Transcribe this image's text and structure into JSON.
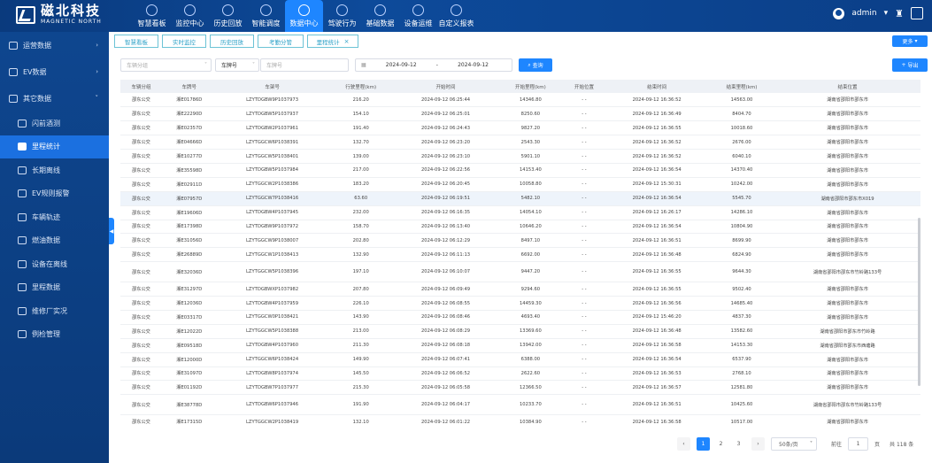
{
  "brand": {
    "cn": "磁北科技",
    "en": "MAGNETIC NORTH"
  },
  "nav": [
    {
      "label": "智慧看板",
      "icon": "dashboard-icon"
    },
    {
      "label": "监控中心",
      "icon": "monitor-icon"
    },
    {
      "label": "历史回放",
      "icon": "replay-icon"
    },
    {
      "label": "智能调度",
      "icon": "dispatch-icon"
    },
    {
      "label": "数据中心",
      "icon": "data-icon",
      "active": true
    },
    {
      "label": "驾驶行为",
      "icon": "driving-icon"
    },
    {
      "label": "基础数据",
      "icon": "database-icon"
    },
    {
      "label": "设备运维",
      "icon": "device-icon"
    },
    {
      "label": "自定义报表",
      "icon": "report-icon"
    }
  ],
  "user": {
    "name": "admin"
  },
  "sidebar": [
    {
      "label": "运营数据",
      "type": "group",
      "chev": "›"
    },
    {
      "label": "EV数据",
      "type": "group",
      "chev": "›"
    },
    {
      "label": "其它数据",
      "type": "group",
      "chev": "˅"
    },
    {
      "label": "闪前酒测",
      "type": "sub"
    },
    {
      "label": "里程统计",
      "type": "sub",
      "active": true
    },
    {
      "label": "长期离线",
      "type": "sub"
    },
    {
      "label": "EV规则报警",
      "type": "sub"
    },
    {
      "label": "车辆轨迹",
      "type": "sub"
    },
    {
      "label": "燃油数据",
      "type": "sub"
    },
    {
      "label": "设备在离线",
      "type": "sub"
    },
    {
      "label": "里程数据",
      "type": "sub"
    },
    {
      "label": "维修厂实况",
      "type": "sub"
    },
    {
      "label": "例检管理",
      "type": "sub"
    }
  ],
  "tabs": [
    {
      "label": "智慧看板"
    },
    {
      "label": "实时监控"
    },
    {
      "label": "历史回放"
    },
    {
      "label": "考勤分管"
    },
    {
      "label": "里程统计",
      "active": true,
      "close": "×"
    }
  ],
  "more_label": "更多",
  "filters": {
    "group_placeholder": "车辆分组",
    "plate_select": "车牌号",
    "plate_placeholder": "车牌号",
    "date_start": "2024-09-12",
    "date_sep": "-",
    "date_end": "2024-09-12",
    "query_label": "查询",
    "export_label": "导出"
  },
  "table": {
    "columns": [
      "车辆分组",
      "车牌号",
      "车架号",
      "行驶里程(km)",
      "开始时间",
      "开始里程(km)",
      "开始位置",
      "结束时间",
      "结束里程(km)",
      "结束位置"
    ],
    "rows": [
      [
        "邵东公交",
        "湘E01786D",
        "LZYTDGBW9P1037973",
        "216.20",
        "2024-09-12 06:25:44",
        "14346.80",
        "- -",
        "2024-09-12 16:36:52",
        "14563.00",
        "湖南省邵阳市邵东市"
      ],
      [
        "邵东公交",
        "湘E22290D",
        "LZYTDGBW5P1037937",
        "154.10",
        "2024-09-12 06:25:01",
        "8250.60",
        "- -",
        "2024-09-12 16:36:49",
        "8404.70",
        "湖南省邵阳市邵东市"
      ],
      [
        "邵东公交",
        "湘E02357D",
        "LZYTDGBW2P1037961",
        "191.40",
        "2024-09-12 06:24:43",
        "9827.20",
        "- -",
        "2024-09-12 16:36:55",
        "10018.60",
        "湖南省邵阳市邵东市"
      ],
      [
        "邵东公交",
        "湘E04666D",
        "LZYTGGCW6P1038391",
        "132.70",
        "2024-09-12 06:23:20",
        "2543.30",
        "- -",
        "2024-09-12 16:36:52",
        "2676.00",
        "湖南省邵阳市邵东市"
      ],
      [
        "邵东公交",
        "湘E10277D",
        "LZYTGGCW5P1038401",
        "139.00",
        "2024-09-12 06:23:10",
        "5901.10",
        "- -",
        "2024-09-12 16:36:52",
        "6040.10",
        "湖南省邵阳市邵东市"
      ],
      [
        "邵东公交",
        "湘E35598D",
        "LZYTDGBW5P1037984",
        "217.00",
        "2024-09-12 06:22:56",
        "14153.40",
        "- -",
        "2024-09-12 16:36:54",
        "14370.40",
        "湖南省邵阳市邵东市"
      ],
      [
        "邵东公交",
        "湘E02911D",
        "LZYTGGCW2P1038386",
        "183.20",
        "2024-09-12 06:20:45",
        "10058.80",
        "- -",
        "2024-09-12 15:30:31",
        "10242.00",
        "湖南省邵阳市邵东市"
      ],
      [
        "邵东公交",
        "湘E07957D",
        "LZYTGGCW7P1038416",
        "63.60",
        "2024-09-12 06:19:51",
        "5482.10",
        "- -",
        "2024-09-12 16:36:54",
        "5545.70",
        "湖南省邵阳市邵东市X019"
      ],
      [
        "邵东公交",
        "湘E19606D",
        "LZYTDGBW4P1037945",
        "232.00",
        "2024-09-12 06:16:35",
        "14054.10",
        "- -",
        "2024-09-12 16:26:17",
        "14286.10",
        "湖南省邵阳市邵东市"
      ],
      [
        "邵东公交",
        "湘E17398D",
        "LZYTDGBW9P1037972",
        "158.70",
        "2024-09-12 06:13:40",
        "10646.20",
        "- -",
        "2024-09-12 16:36:54",
        "10804.90",
        "湖南省邵阳市邵东市"
      ],
      [
        "邵东公交",
        "湘E31056D",
        "LZYTGGCW9P1038007",
        "202.80",
        "2024-09-12 06:12:29",
        "8497.10",
        "- -",
        "2024-09-12 16:36:51",
        "8699.90",
        "湖南省邵阳市邵东市"
      ],
      [
        "邵东公交",
        "湘E26889D",
        "LZYTGGCW1P1038413",
        "132.90",
        "2024-09-12 06:11:13",
        "6692.00",
        "- -",
        "2024-09-12 16:36:48",
        "6824.90",
        "湖南省邵阳市邵东市"
      ],
      [
        "邵东公交",
        "湘E32036D",
        "LZYTGGCW5P1038396",
        "197.10",
        "2024-09-12 06:10:07",
        "9447.20",
        "- -",
        "2024-09-12 16:36:55",
        "9644.30",
        "湖南省邵阳市邵东市竹岭路133号"
      ],
      [
        "邵东公交",
        "湘E31297D",
        "LZYTDGBWXP1037982",
        "207.80",
        "2024-09-12 06:09:49",
        "9294.60",
        "- -",
        "2024-09-12 16:36:55",
        "9502.40",
        "湖南省邵阳市邵东市"
      ],
      [
        "邵东公交",
        "湘E12036D",
        "LZYTDGBW4P1037959",
        "226.10",
        "2024-09-12 06:08:55",
        "14459.30",
        "- -",
        "2024-09-12 16:36:56",
        "14685.40",
        "湖南省邵阳市邵东市"
      ],
      [
        "邵东公交",
        "湘E03317D",
        "LZYTGGCW0P1038421",
        "143.90",
        "2024-09-12 06:08:46",
        "4693.40",
        "- -",
        "2024-09-12 15:46:20",
        "4837.30",
        "湖南省邵阳市邵东市"
      ],
      [
        "邵东公交",
        "湘E12022D",
        "LZYTGGCW5P1038388",
        "213.00",
        "2024-09-12 06:08:29",
        "13369.60",
        "- -",
        "2024-09-12 16:36:48",
        "13582.60",
        "湖南省邵阳市邵东市竹岭路"
      ],
      [
        "邵东公交",
        "湘E09518D",
        "LZYTDGBW4P1037960",
        "211.30",
        "2024-09-12 06:08:18",
        "13942.00",
        "- -",
        "2024-09-12 16:36:58",
        "14153.30",
        "湖南省邵阳市邵东市西塘路"
      ],
      [
        "邵东公交",
        "湘E12000D",
        "LZYTGGCW6P1038424",
        "149.90",
        "2024-09-12 06:07:41",
        "6388.00",
        "- -",
        "2024-09-12 16:36:54",
        "6537.90",
        "湖南省邵阳市邵东市"
      ],
      [
        "邵东公交",
        "湘E31097D",
        "LZYTDGBW8P1037974",
        "145.50",
        "2024-09-12 06:06:52",
        "2622.60",
        "- -",
        "2024-09-12 16:36:53",
        "2768.10",
        "湖南省邵阳市邵东市"
      ],
      [
        "邵东公交",
        "湘E01192D",
        "LZYTDGBW7P1037977",
        "215.30",
        "2024-09-12 06:05:58",
        "12366.50",
        "- -",
        "2024-09-12 16:36:57",
        "12581.80",
        "湖南省邵阳市邵东市"
      ],
      [
        "邵东公交",
        "湘E38778D",
        "LZYTDGBW6P1037946",
        "191.90",
        "2024-09-12 06:04:17",
        "10233.70",
        "- -",
        "2024-09-12 16:36:51",
        "10425.60",
        "湖南省邵阳市邵东市竹岭路133号"
      ],
      [
        "邵东公交",
        "湘E17315D",
        "LZYTGGCW2P1038419",
        "132.10",
        "2024-09-12 06:01:22",
        "10384.90",
        "- -",
        "2024-09-12 16:36:58",
        "10517.00",
        "湖南省邵阳市邵东市"
      ]
    ]
  },
  "pagination": {
    "prev": "‹",
    "pages": [
      "1",
      "2",
      "3"
    ],
    "next": "›",
    "page_size": "50条/页",
    "goto_prefix": "前往",
    "goto_value": "1",
    "goto_suffix": "页",
    "total": "共 118 条"
  },
  "colors": {
    "accent": "#1e86ff",
    "header": "#0d4a9a",
    "sidebar": "#0e468f",
    "tab_border": "#6cc3d6"
  }
}
